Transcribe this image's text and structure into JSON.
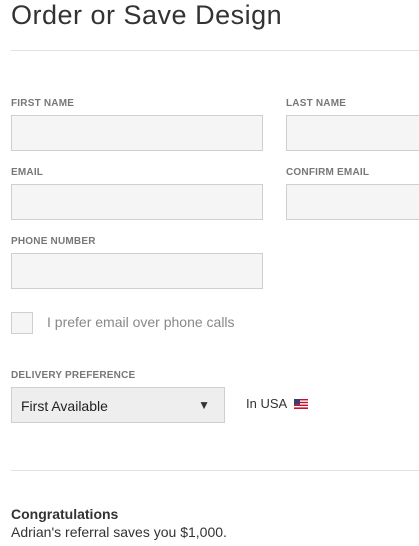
{
  "title": "Order or Save Design",
  "form": {
    "first_name": {
      "label": "FIRST NAME",
      "value": ""
    },
    "last_name": {
      "label": "LAST NAME",
      "value": ""
    },
    "email": {
      "label": "EMAIL",
      "value": ""
    },
    "confirm_email": {
      "label": "CONFIRM EMAIL",
      "value": ""
    },
    "phone": {
      "label": "PHONE NUMBER",
      "value": ""
    },
    "prefer_email": {
      "label": "I prefer email over phone calls",
      "checked": false
    },
    "delivery": {
      "label": "DELIVERY PREFERENCE",
      "selected": "First Available",
      "arrow": "▼",
      "region": "In USA",
      "region_icon": "us-flag-icon"
    }
  },
  "congrats": {
    "title": "Congratulations",
    "text": "Adrian's referral saves you $1,000."
  }
}
